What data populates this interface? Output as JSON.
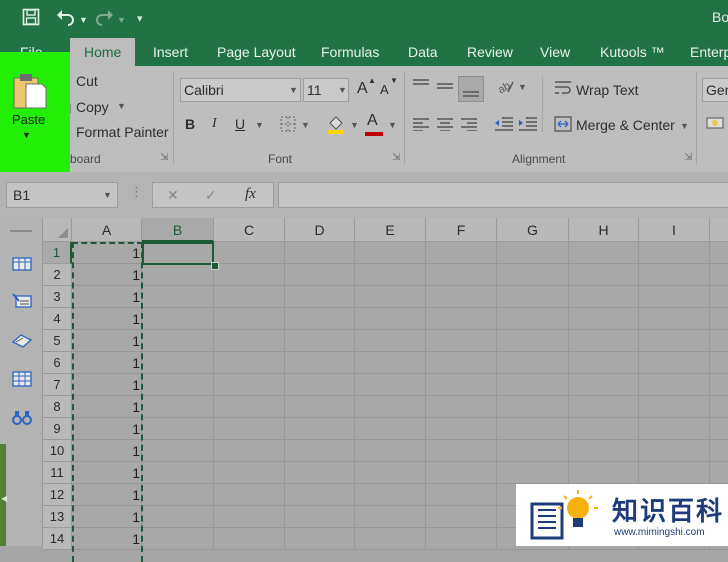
{
  "titlebar": {
    "title": "Bo"
  },
  "tabs": [
    "File",
    "Home",
    "Insert",
    "Page Layout",
    "Formulas",
    "Data",
    "Review",
    "View",
    "Kutools ™",
    "Enterp"
  ],
  "clipboard": {
    "paste": "Paste",
    "cut": "Cut",
    "copy": "Copy",
    "format_painter": "Format Painter",
    "group": "board"
  },
  "font": {
    "name": "Calibri",
    "size": "11",
    "bold": "B",
    "italic": "I",
    "underline": "U",
    "grow": "A",
    "shrink": "A",
    "color_letter": "A",
    "group": "Font"
  },
  "alignment": {
    "wrap": "Wrap Text",
    "merge": "Merge & Center",
    "group": "Alignment"
  },
  "number": {
    "format": "Gen"
  },
  "formula_bar": {
    "name_box": "B1",
    "fx": "fx",
    "cancel": "✕",
    "enter": "✓"
  },
  "columns": [
    "A",
    "B",
    "C",
    "D",
    "E",
    "F",
    "G",
    "H",
    "I"
  ],
  "rows": [
    "1",
    "2",
    "3",
    "4",
    "5",
    "6",
    "7",
    "8",
    "9",
    "10",
    "11",
    "12",
    "13",
    "14"
  ],
  "column_a_values": [
    "1",
    "1",
    "1",
    "1",
    "1",
    "1",
    "1",
    "1",
    "1",
    "1",
    "1",
    "1",
    "1",
    "1"
  ],
  "watermark": {
    "text": "知识百科",
    "url": "www.mimingshi.com"
  },
  "colors": {
    "excel_green": "#217346",
    "highlight": "#22ee06",
    "font_red": "#c00000",
    "fill_yellow": "#ffd700"
  }
}
